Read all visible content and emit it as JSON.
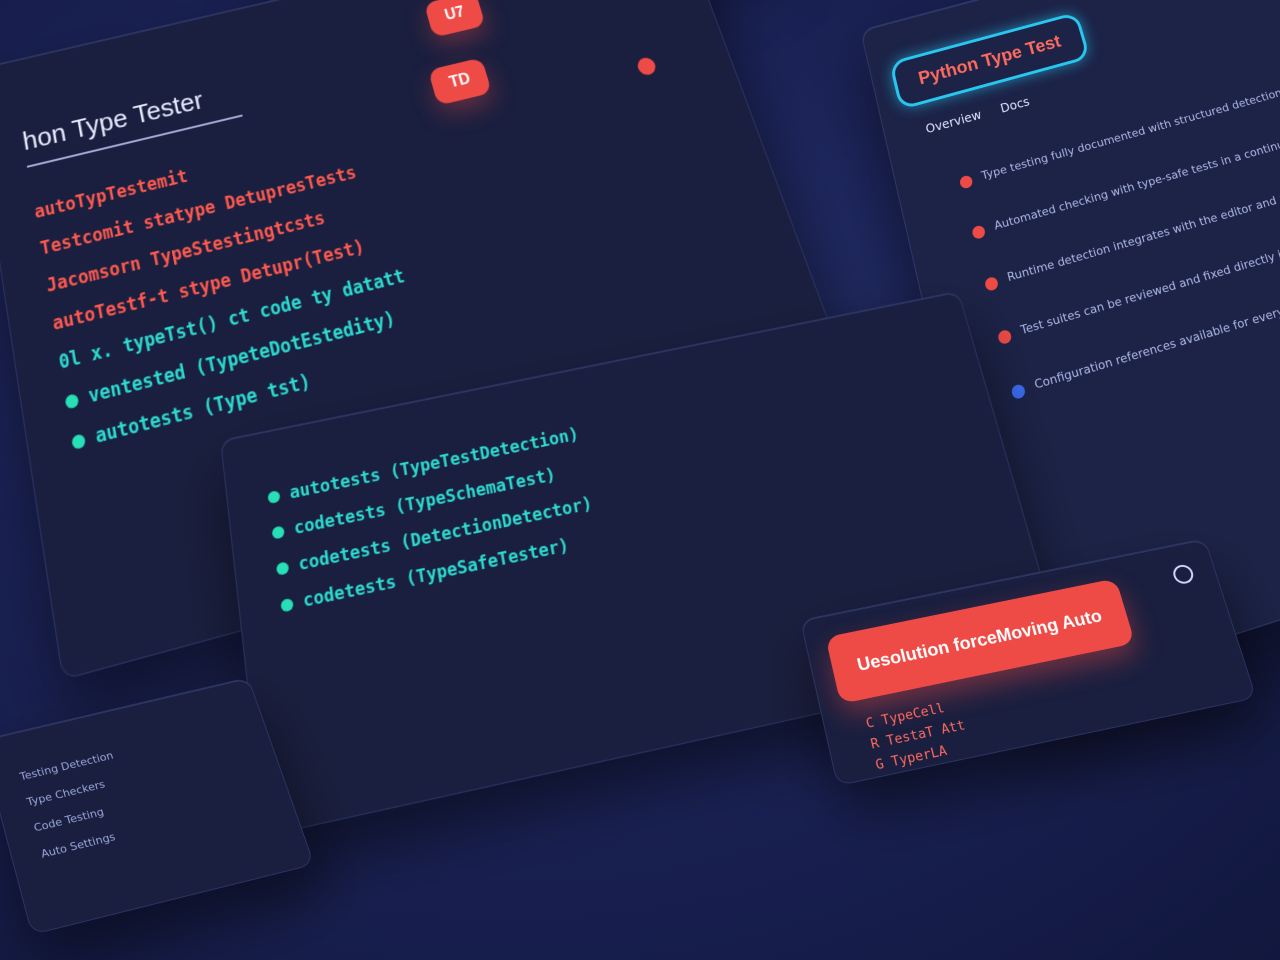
{
  "editor": {
    "title": "hon Type Tester",
    "badges": [
      "U7",
      "TD"
    ],
    "lines": [
      {
        "color": "red",
        "text": "autoTypTestemit"
      },
      {
        "color": "red",
        "text": "Testcomit  statype DetupresTests"
      },
      {
        "color": "red",
        "text": "Jacomsorn TypeStestingtcsts"
      },
      {
        "color": "red",
        "text": "autoTestf-t stype Detupr(Test)"
      },
      {
        "color": "teal",
        "text": "0l x.  typeTst()  ct code  ty datatt"
      },
      {
        "color": "teal",
        "text": "ventested (TypeteDotEstedity)"
      },
      {
        "color": "teal",
        "text": "autotests (Type tst)"
      }
    ]
  },
  "lower": {
    "lines": [
      {
        "color": "teal",
        "text": "autotests (TypeTestDetection)"
      },
      {
        "color": "teal",
        "text": "codetests (TypeSchemaTest)"
      },
      {
        "color": "teal",
        "text": "codetests (DetectionDetector)"
      },
      {
        "color": "teal",
        "text": "codetests (TypeSafeTester)"
      }
    ]
  },
  "action": {
    "button_label": "Uesolution forceMoving Auto",
    "tags": [
      "C TypeCell",
      "R TestaT Att",
      "G TyperLA"
    ]
  },
  "docs": {
    "logo": "Python Type Test",
    "tabs": [
      "Overview",
      "Docs"
    ],
    "items": [
      {
        "text": "Type testing fully documented with structured detection and examples"
      },
      {
        "text": "Automated checking with type-safe tests in a continuous workflow"
      },
      {
        "text": "Runtime detection integrates with the editor and reports results"
      },
      {
        "text": "Test suites can be reviewed and fixed directly in place"
      },
      {
        "text": "Configuration references available for every checker"
      }
    ]
  },
  "mini": {
    "lines": [
      "Testing Detection",
      "Type Checkers",
      "Code Testing",
      "Auto Settings"
    ]
  },
  "colors": {
    "accent_red": "#ef4b46",
    "accent_teal": "#27e0b7",
    "accent_cyan": "#29c7f0",
    "panel": "#1a1f3f"
  }
}
